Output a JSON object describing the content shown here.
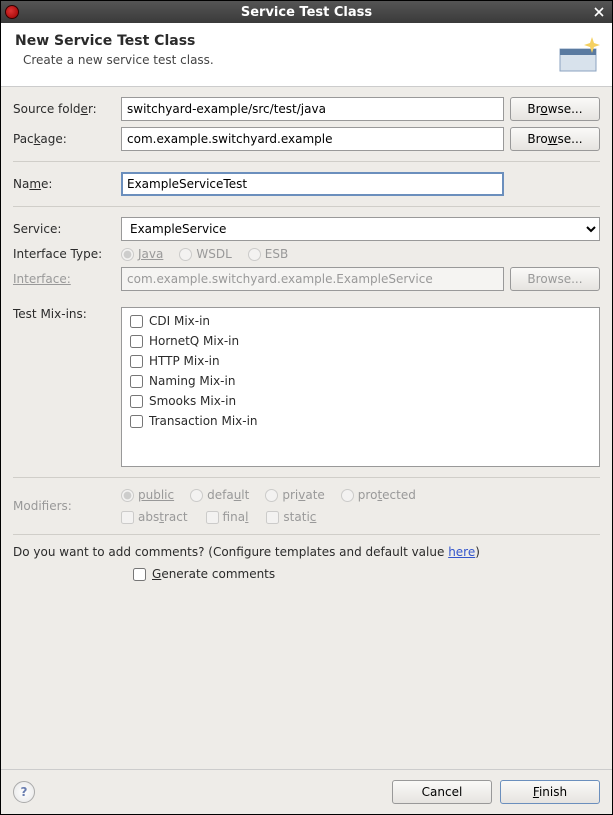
{
  "window": {
    "title": "Service Test Class"
  },
  "header": {
    "title": "New Service Test Class",
    "subtitle": "Create a new service test class."
  },
  "labels": {
    "source_folder": "Source folder:",
    "package": "Package:",
    "name": "Name:",
    "service": "Service:",
    "interface_type": "Interface Type:",
    "interface": "Interface:",
    "test_mixins": "Test Mix-ins:",
    "modifiers": "Modifiers:"
  },
  "buttons": {
    "browse": "Browse...",
    "cancel": "Cancel",
    "finish": "Finish"
  },
  "fields": {
    "source_folder": "switchyard-example/src/test/java",
    "package": "com.example.switchyard.example",
    "name": "ExampleServiceTest",
    "service": "ExampleService",
    "interface": "com.example.switchyard.example.ExampleService"
  },
  "interface_types": {
    "java": "Java",
    "wsdl": "WSDL",
    "esb": "ESB"
  },
  "mixins": [
    "CDI Mix-in",
    "HornetQ Mix-in",
    "HTTP Mix-in",
    "Naming Mix-in",
    "Smooks Mix-in",
    "Transaction Mix-in"
  ],
  "modifiers": {
    "public": "public",
    "default": "default",
    "private": "private",
    "protected": "protected",
    "abstract": "abstract",
    "final": "final",
    "static": "static"
  },
  "comments": {
    "prefix": "Do you want to add comments? (Configure templates and default value ",
    "link": "here",
    "suffix": ")",
    "generate": "Generate comments"
  }
}
